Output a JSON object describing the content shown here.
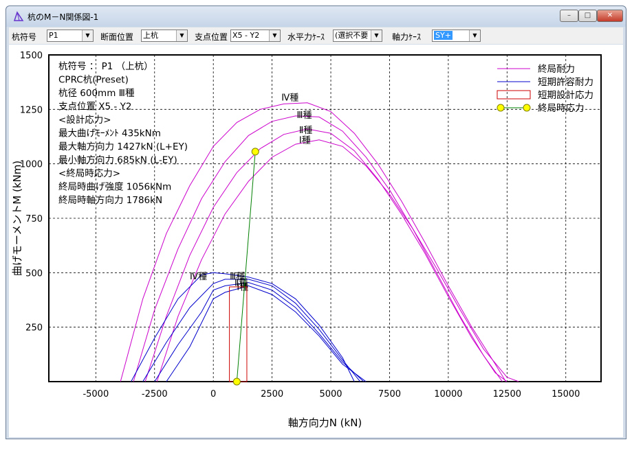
{
  "window": {
    "title": "杭のM－N関係図-1",
    "buttons": {
      "minimize": "–",
      "maximize": "□",
      "close": "✕"
    }
  },
  "toolbar": {
    "pile_label": "杭符号",
    "pile_value": "P1",
    "section_label": "断面位置",
    "section_value": "上杭",
    "support_label": "支点位置",
    "support_value": "X5 - Y2",
    "horizontal_label": "水平力ｹｰｽ",
    "horizontal_value": "(選択不要",
    "axial_label": "軸力ｹｰｽ",
    "axial_value": "SY+"
  },
  "info": {
    "lines": [
      "杭符号 ： P1 （上杭）",
      "CPRC杭(Preset)",
      "杭径 600mm Ⅲ種",
      "支点位置 X5 - Y2",
      "<設計応力>",
      "最大曲げﾓｰﾒﾝﾄ  435kNm",
      "最大軸方向力  1427kN (L+EY)",
      "最小軸方向力    685kN (L-EY)",
      "<終局時応力>",
      "終局時曲げ強度 1056kNm",
      "終局時軸方向力  1786kN"
    ]
  },
  "chart_data": {
    "type": "line",
    "xlabel": "軸方向力N (kN)",
    "ylabel": "曲げモーメントM (kNm)",
    "xlim": [
      -7000,
      16500
    ],
    "ylim": [
      0,
      1500
    ],
    "xticks": [
      -5000,
      -2500,
      0,
      2500,
      5000,
      7500,
      10000,
      12500,
      15000
    ],
    "yticks": [
      250,
      500,
      750,
      1000,
      1250,
      1500
    ],
    "grid": true,
    "legend": [
      {
        "label": "終局耐力",
        "color": "#cc00cc",
        "kind": "line"
      },
      {
        "label": "短期許容耐力",
        "color": "#0000cc",
        "kind": "line"
      },
      {
        "label": "短期設計応力",
        "color": "#cc0000",
        "kind": "box"
      },
      {
        "label": "終局時応力",
        "color": "#008000",
        "kind": "dots"
      }
    ],
    "ultimate": [
      {
        "name": "Ⅳ種",
        "points": [
          [
            -3950,
            0
          ],
          [
            -3000,
            380
          ],
          [
            -2000,
            680
          ],
          [
            -1000,
            900
          ],
          [
            0,
            1080
          ],
          [
            1000,
            1190
          ],
          [
            2000,
            1250
          ],
          [
            3000,
            1275
          ],
          [
            4000,
            1280
          ],
          [
            5000,
            1240
          ],
          [
            6000,
            1140
          ],
          [
            7000,
            1000
          ],
          [
            8000,
            830
          ],
          [
            9000,
            640
          ],
          [
            10000,
            440
          ],
          [
            11000,
            250
          ],
          [
            12000,
            80
          ],
          [
            12450,
            0
          ]
        ]
      },
      {
        "name": "Ⅲ種",
        "points": [
          [
            -3400,
            0
          ],
          [
            -2500,
            330
          ],
          [
            -1500,
            610
          ],
          [
            -500,
            840
          ],
          [
            500,
            1010
          ],
          [
            1500,
            1130
          ],
          [
            2500,
            1195
          ],
          [
            3500,
            1220
          ],
          [
            4500,
            1215
          ],
          [
            5500,
            1150
          ],
          [
            6500,
            1030
          ],
          [
            7500,
            880
          ],
          [
            8500,
            700
          ],
          [
            9500,
            500
          ],
          [
            10500,
            300
          ],
          [
            11500,
            120
          ],
          [
            12300,
            0
          ]
        ]
      },
      {
        "name": "Ⅱ種",
        "points": [
          [
            -2900,
            0
          ],
          [
            -2000,
            300
          ],
          [
            -1000,
            580
          ],
          [
            0,
            800
          ],
          [
            1000,
            960
          ],
          [
            2000,
            1070
          ],
          [
            3000,
            1135
          ],
          [
            4000,
            1160
          ],
          [
            5000,
            1140
          ],
          [
            6000,
            1060
          ],
          [
            7000,
            930
          ],
          [
            8000,
            770
          ],
          [
            9000,
            590
          ],
          [
            10000,
            390
          ],
          [
            11000,
            200
          ],
          [
            12000,
            40
          ],
          [
            12500,
            0
          ]
        ]
      },
      {
        "name": "Ⅰ種",
        "points": [
          [
            -2400,
            0
          ],
          [
            -1500,
            300
          ],
          [
            -500,
            560
          ],
          [
            500,
            770
          ],
          [
            1500,
            920
          ],
          [
            2500,
            1030
          ],
          [
            3500,
            1090
          ],
          [
            4500,
            1110
          ],
          [
            5500,
            1080
          ],
          [
            6500,
            990
          ],
          [
            7500,
            860
          ],
          [
            8500,
            700
          ],
          [
            9500,
            520
          ],
          [
            10500,
            330
          ],
          [
            11500,
            150
          ],
          [
            12500,
            20
          ],
          [
            13000,
            0
          ]
        ]
      }
    ],
    "ultimate_labels": [
      {
        "text": "Ⅳ種",
        "x": 2900,
        "y": 1290
      },
      {
        "text": "Ⅲ種",
        "x": 3550,
        "y": 1210
      },
      {
        "text": "Ⅱ種",
        "x": 3650,
        "y": 1140
      },
      {
        "text": "Ⅰ種",
        "x": 3650,
        "y": 1095
      }
    ],
    "allowable": [
      {
        "name": "Ⅳ種",
        "points": [
          [
            -3500,
            0
          ],
          [
            -2500,
            200
          ],
          [
            -1500,
            380
          ],
          [
            -500,
            490
          ],
          [
            0,
            500
          ],
          [
            500,
            495
          ],
          [
            1500,
            480
          ],
          [
            2500,
            450
          ],
          [
            3500,
            380
          ],
          [
            4500,
            260
          ],
          [
            5500,
            110
          ],
          [
            6000,
            0
          ]
        ]
      },
      {
        "name": "Ⅲ種",
        "points": [
          [
            -3000,
            0
          ],
          [
            -2000,
            180
          ],
          [
            -1000,
            340
          ],
          [
            0,
            450
          ],
          [
            500,
            470
          ],
          [
            1500,
            470
          ],
          [
            2500,
            440
          ],
          [
            3500,
            360
          ],
          [
            4500,
            240
          ],
          [
            5500,
            100
          ],
          [
            6250,
            0
          ]
        ]
      },
      {
        "name": "Ⅱ種",
        "points": [
          [
            -2500,
            0
          ],
          [
            -1500,
            170
          ],
          [
            -500,
            320
          ],
          [
            0,
            420
          ],
          [
            500,
            440
          ],
          [
            1500,
            455
          ],
          [
            2500,
            420
          ],
          [
            3500,
            340
          ],
          [
            4500,
            220
          ],
          [
            5500,
            90
          ],
          [
            6400,
            0
          ]
        ]
      },
      {
        "name": "Ⅰ種",
        "points": [
          [
            -2000,
            0
          ],
          [
            -1000,
            160
          ],
          [
            0,
            380
          ],
          [
            500,
            410
          ],
          [
            1500,
            440
          ],
          [
            2500,
            400
          ],
          [
            3500,
            320
          ],
          [
            4500,
            210
          ],
          [
            5500,
            80
          ],
          [
            6500,
            0
          ]
        ]
      }
    ],
    "allowable_labels": [
      {
        "text": "Ⅳ種",
        "x": -1000,
        "y": 470
      },
      {
        "text": "Ⅲ種",
        "x": 700,
        "y": 470
      },
      {
        "text": "Ⅱ種",
        "x": 900,
        "y": 440
      },
      {
        "text": "Ⅰ種",
        "x": 1000,
        "y": 420
      }
    ],
    "design_box": {
      "n_min": 685,
      "n_max": 1427,
      "m_max": 435
    },
    "ultimate_stress": {
      "start": [
        1000,
        0
      ],
      "end": [
        1786,
        1056
      ]
    }
  }
}
